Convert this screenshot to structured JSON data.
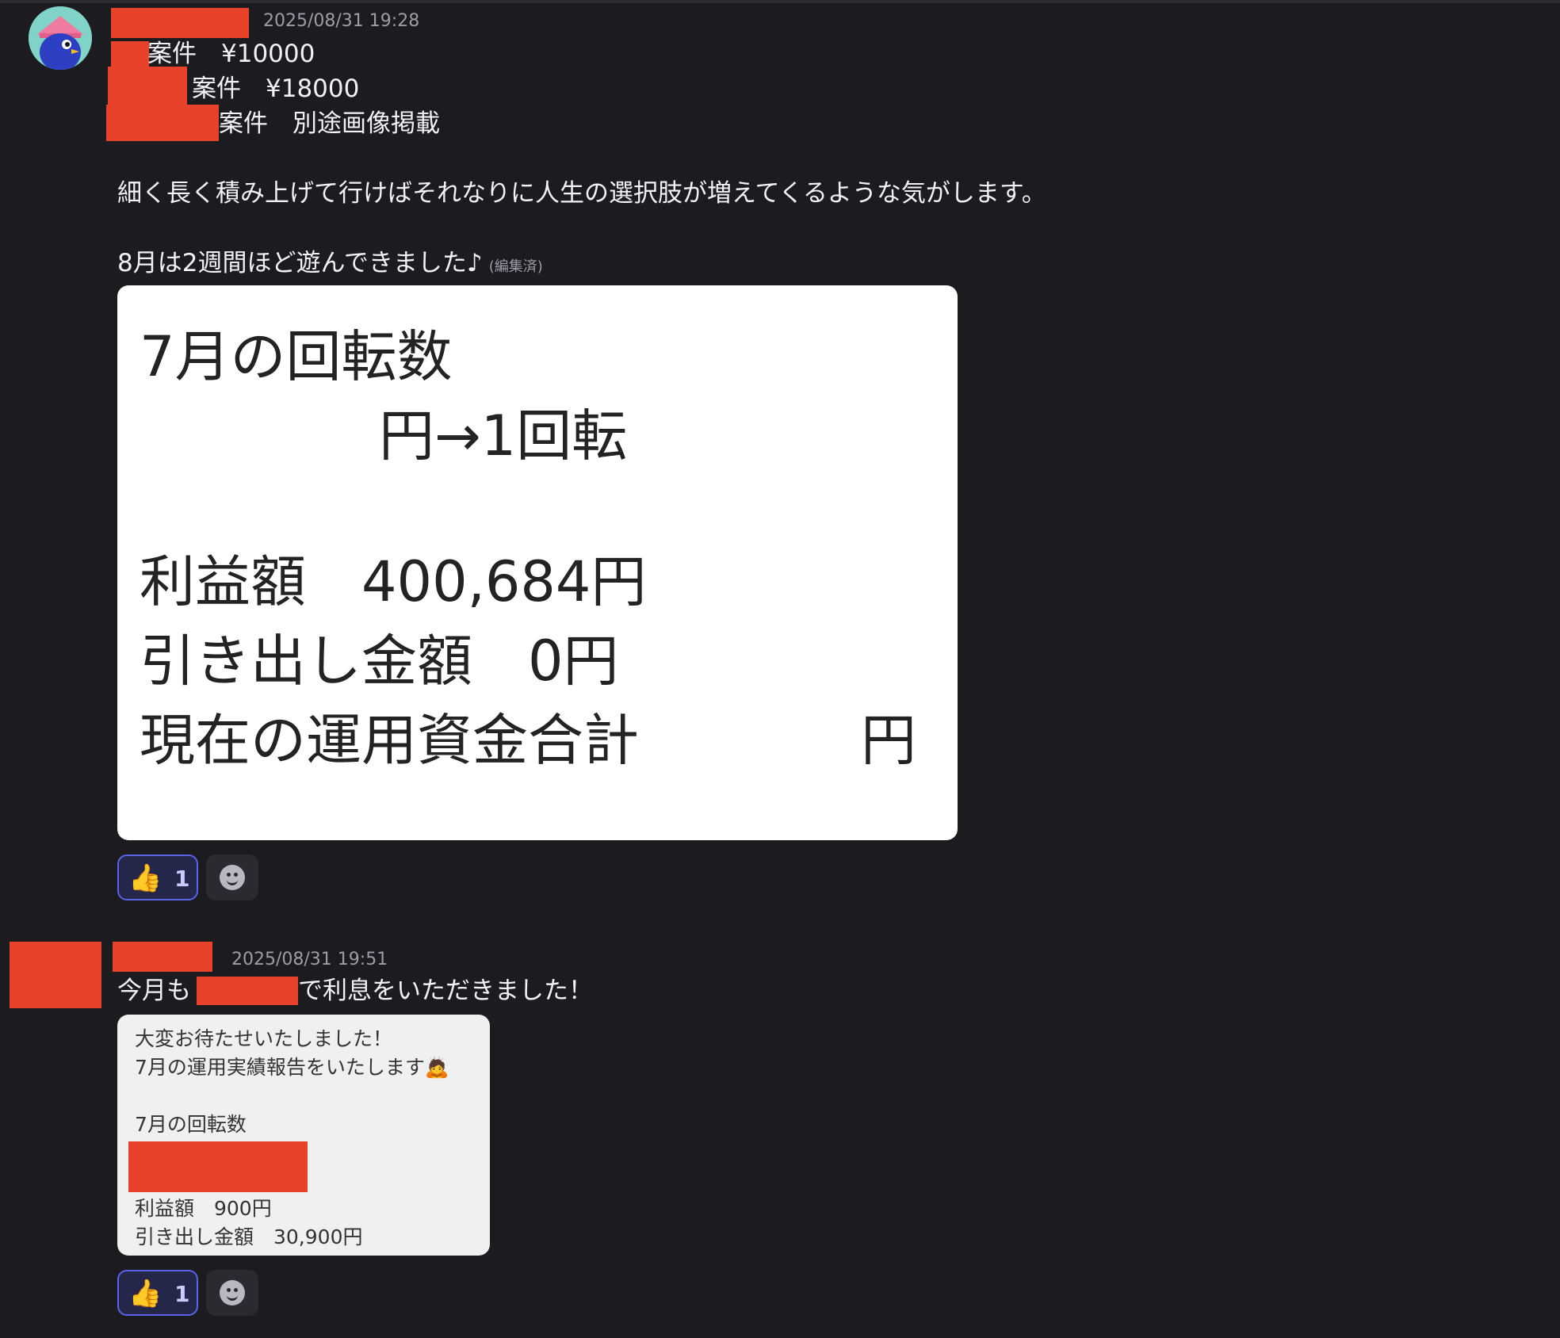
{
  "post1": {
    "timestamp": "2025/08/31 19:28",
    "lines": [
      "案件　¥10000",
      "案件　¥18000",
      "案件　別途画像掲載"
    ],
    "body": "細く長く積み上げて行けばそれなりに人生の選択肢が増えてくるような気がします。",
    "body2": "8月は2週間ほど遊んできました♪",
    "edited": "(編集済)",
    "image": {
      "line1": "7月の回転数",
      "line2": "円→1回転",
      "line3": "利益額　400,684円",
      "line4": "引き出し金額　0円",
      "line5": "現在の運用資金合計",
      "line5_end": "円"
    },
    "reaction": {
      "emoji": "👍",
      "count": "1"
    }
  },
  "post2": {
    "timestamp": "2025/08/31 19:51",
    "text_before": "今月も",
    "text_after": "で利息をいただきました！",
    "image": {
      "line1": "大変お待たせいたしました！",
      "line2": "7月の運用実績報告をいたします🙇",
      "line3": "7月の回転数",
      "line4": "利益額　900円",
      "line5": "引き出し金額　30,900円"
    },
    "reaction": {
      "emoji": "👍",
      "count": "1"
    }
  },
  "colors": {
    "background": "#1b1b20",
    "redaction": "#e8432a",
    "reaction_border": "#5b63e8",
    "timestamp": "#9d9da6"
  },
  "icons": [
    "avatar",
    "thumbs-up-icon",
    "add-reaction-smiley-icon"
  ]
}
